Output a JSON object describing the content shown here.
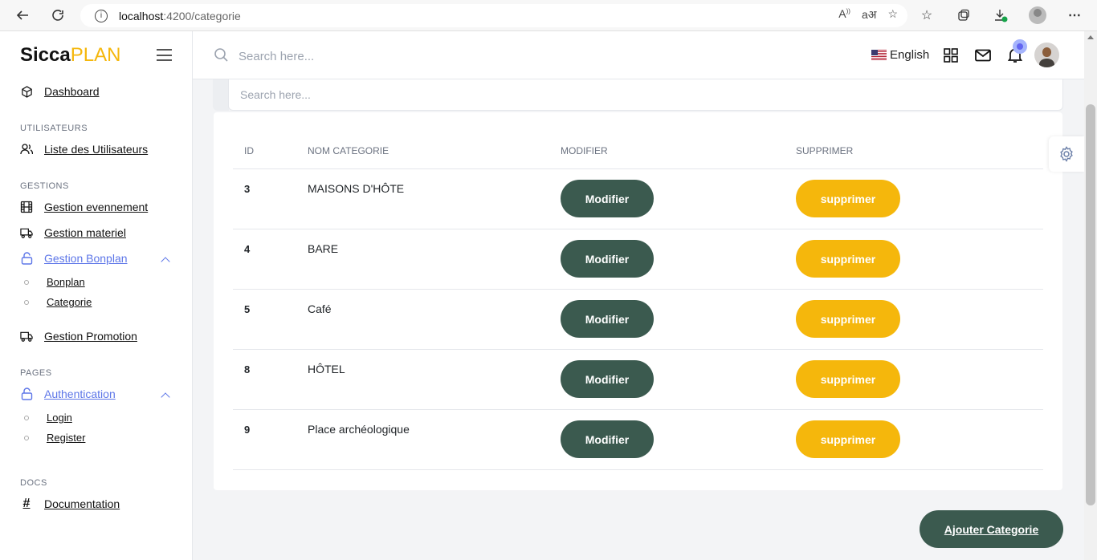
{
  "browser": {
    "url_host": "localhost",
    "url_path": ":4200/categorie"
  },
  "brand": {
    "part1": "Sicca",
    "part2": "PLAN"
  },
  "sidebar": {
    "dashboard": "Dashboard",
    "section_users": "UTILISATEURS",
    "users_list": "Liste des Utilisateurs",
    "section_gestions": "GESTIONS",
    "gestion_evenement": "Gestion evennement",
    "gestion_materiel": "Gestion materiel",
    "gestion_bonplan": "Gestion Bonplan",
    "bonplan": "Bonplan",
    "categorie": "Categorie",
    "gestion_promotion": "Gestion Promotion",
    "section_pages": "PAGES",
    "authentication": "Authentication",
    "login": "Login",
    "register": "Register",
    "section_docs": "DOCS",
    "documentation": "Documentation"
  },
  "header": {
    "search_placeholder": "Search here...",
    "language": "English"
  },
  "inner_search_placeholder": "Search here...",
  "table": {
    "headers": {
      "id": "ID",
      "name": "NOM CATEGORIE",
      "modify": "MODIFIER",
      "delete": "SUPPRIMER"
    },
    "rows": [
      {
        "id": "3",
        "name": "MAISONS D'HÔTE"
      },
      {
        "id": "4",
        "name": "BARE"
      },
      {
        "id": "5",
        "name": "Café"
      },
      {
        "id": "8",
        "name": "HÔTEL"
      },
      {
        "id": "9",
        "name": "Place archéologique"
      }
    ],
    "modify_label": "Modifier",
    "delete_label": "supprimer"
  },
  "add_button": "Ajouter Categorie",
  "colors": {
    "primary": "#3b5a4f",
    "accent": "#f5b70c",
    "active": "#5d76e8"
  }
}
